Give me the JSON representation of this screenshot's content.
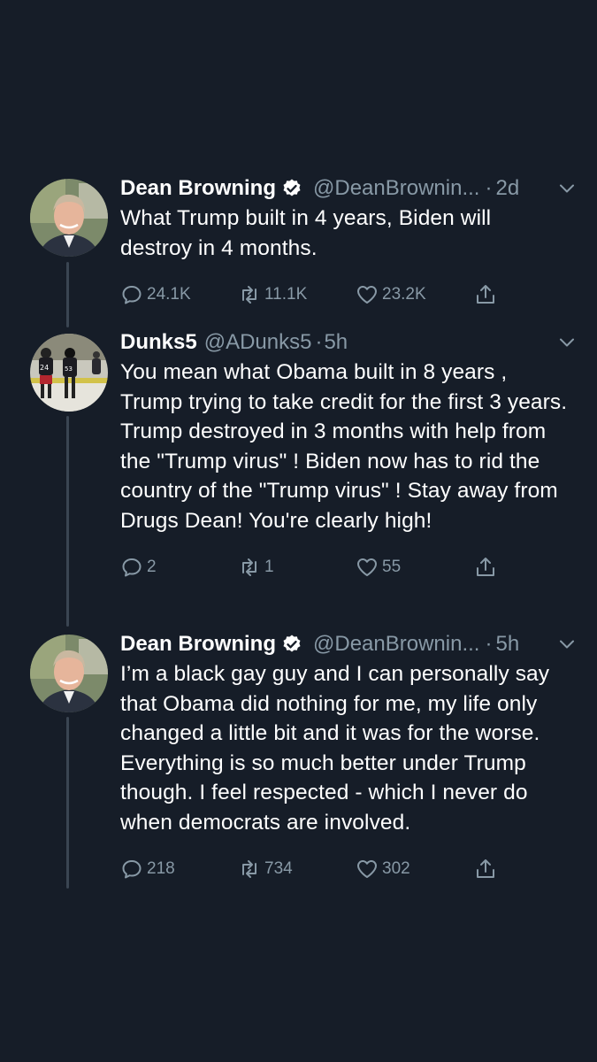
{
  "tweets": [
    {
      "name": "Dean Browning",
      "verified": true,
      "handle": "@DeanBrownin...",
      "time": "2d",
      "text": "What Trump built in 4 years, Biden will destroy in 4 months.",
      "replies": "24.1K",
      "retweets": "11.1K",
      "likes": "23.2K",
      "avatar_icon": "portrait-avatar"
    },
    {
      "name": "Dunks5",
      "verified": false,
      "handle": "@ADunks5",
      "time": "5h",
      "text": "You mean what Obama built in 8 years , Trump trying to take credit for the first 3 years. Trump destroyed in 3 months with help from the \"Trump virus\" ! Biden now has to rid the country of the \"Trump virus\" ! Stay away from Drugs Dean! You're clearly high!",
      "replies": "2",
      "retweets": "1",
      "likes": "55",
      "avatar_icon": "hockey-players-avatar"
    },
    {
      "name": "Dean Browning",
      "verified": true,
      "handle": "@DeanBrownin...",
      "time": "5h",
      "text": "I’m a black gay guy and I can personally say that Obama did nothing for me, my life only changed a little bit and it was for the worse. Everything is so much better under Trump though. I feel respected - which I never do when democrats are involved.",
      "replies": "218",
      "retweets": "734",
      "likes": "302",
      "avatar_icon": "portrait-avatar"
    }
  ],
  "separator": "·",
  "colors": {
    "background": "#161d28",
    "secondary_text": "#8899a6",
    "thread_line": "#3a4552",
    "verified_badge": "#ffffff"
  }
}
